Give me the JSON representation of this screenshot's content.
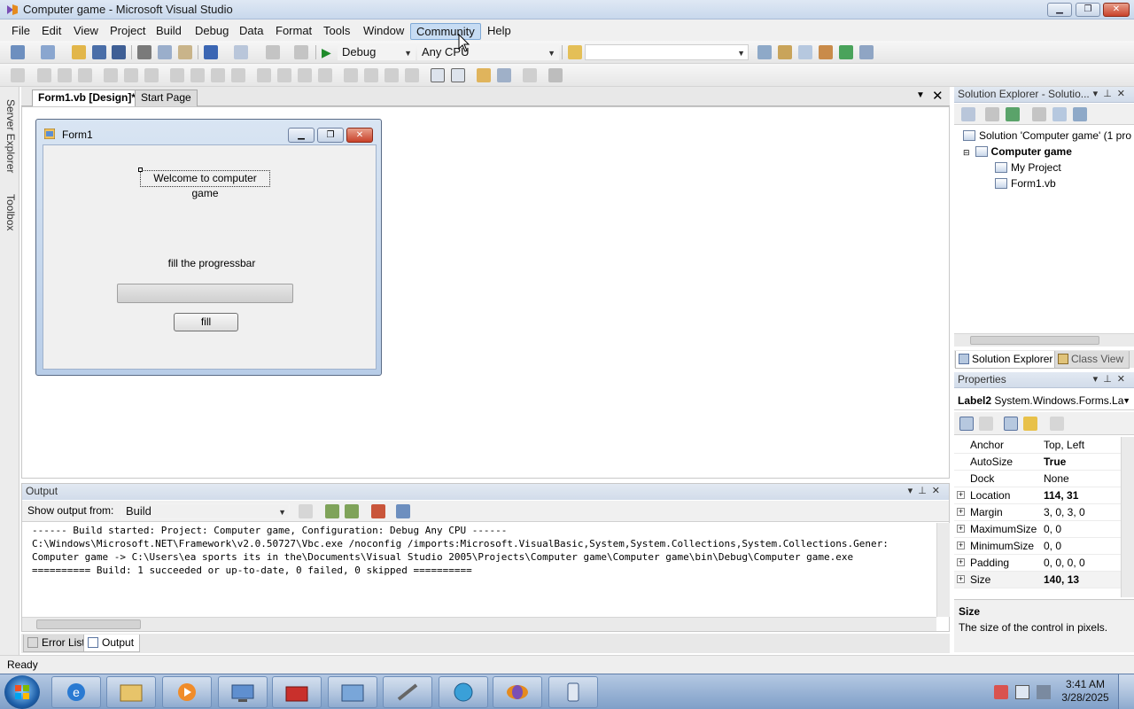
{
  "window": {
    "title": "Computer game - Microsoft Visual Studio",
    "min": "▁",
    "max": "❐",
    "close": "✕"
  },
  "menu": [
    "File",
    "Edit",
    "View",
    "Project",
    "Build",
    "Debug",
    "Data",
    "Format",
    "Tools",
    "Window",
    "Community",
    "Help"
  ],
  "toolbar": {
    "config": "Debug",
    "platform": "Any CPU",
    "find": ""
  },
  "side_tabs": {
    "server_explorer": "Server Explorer",
    "toolbox": "Toolbox"
  },
  "doc_tabs": {
    "design": "Form1.vb [Design]*",
    "start": "Start Page"
  },
  "form": {
    "title": "Form1",
    "welcome_label": "Welcome to computer game",
    "instruction_label": "fill the progressbar",
    "progress": 0,
    "fill_button": "fill"
  },
  "solution_explorer": {
    "header": "Solution Explorer - Solutio...",
    "solution": "Solution 'Computer game' (1 pro",
    "project": "Computer game",
    "my_project": "My Project",
    "file": "Form1.vb",
    "tab_solution": "Solution Explorer",
    "tab_class": "Class View"
  },
  "properties": {
    "header": "Properties",
    "object_name": "Label2",
    "object_type": "System.Windows.Forms.La",
    "rows": [
      {
        "name": "Anchor",
        "value": "Top, Left",
        "expand": false,
        "bold": false
      },
      {
        "name": "AutoSize",
        "value": "True",
        "expand": false,
        "bold": true
      },
      {
        "name": "Dock",
        "value": "None",
        "expand": false,
        "bold": false
      },
      {
        "name": "Location",
        "value": "114, 31",
        "expand": true,
        "bold": true
      },
      {
        "name": "Margin",
        "value": "3, 0, 3, 0",
        "expand": true,
        "bold": false
      },
      {
        "name": "MaximumSize",
        "value": "0, 0",
        "expand": true,
        "bold": false
      },
      {
        "name": "MinimumSize",
        "value": "0, 0",
        "expand": true,
        "bold": false
      },
      {
        "name": "Padding",
        "value": "0, 0, 0, 0",
        "expand": true,
        "bold": false
      },
      {
        "name": "Size",
        "value": "140, 13",
        "expand": true,
        "bold": true
      }
    ],
    "desc_title": "Size",
    "desc_text": "The size of the control in pixels."
  },
  "output": {
    "header": "Output",
    "show_from_label": "Show output from:",
    "show_from_value": "Build",
    "lines": [
      "------ Build started: Project: Computer game, Configuration: Debug Any CPU ------",
      "C:\\Windows\\Microsoft.NET\\Framework\\v2.0.50727\\Vbc.exe /noconfig /imports:Microsoft.VisualBasic,System,System.Collections,System.Collections.Gener:",
      "Computer game -> C:\\Users\\ea sports its in the\\Documents\\Visual Studio 2005\\Projects\\Computer game\\Computer game\\bin\\Debug\\Computer game.exe",
      "========== Build: 1 succeeded or up-to-date, 0 failed, 0 skipped =========="
    ]
  },
  "bottom_tabs": {
    "errors": "Error List",
    "output": "Output"
  },
  "status": "Ready",
  "clock": {
    "time": "3:41 AM",
    "date": "3/28/2025"
  },
  "colors": {
    "accent": "#c7dcf3",
    "titlebar": "#dfe8f4",
    "taskbar": "#7f9fc8"
  }
}
